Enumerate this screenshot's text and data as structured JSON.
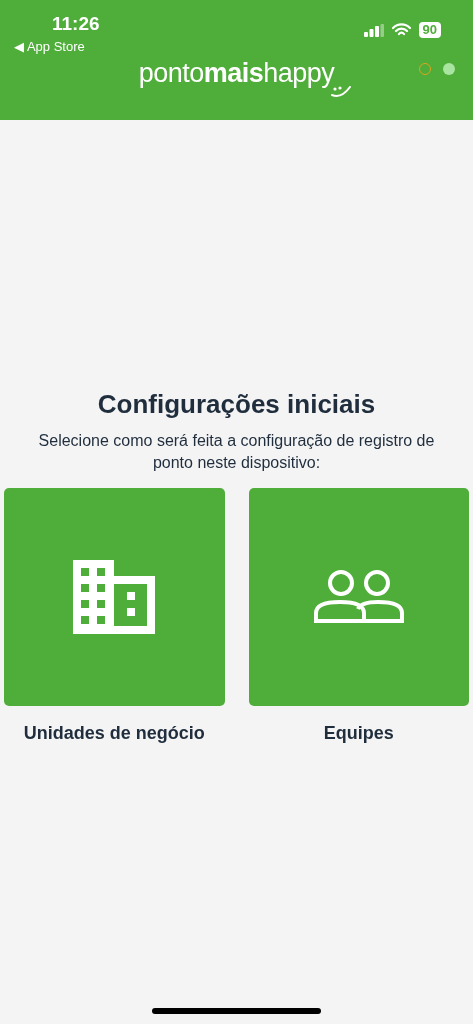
{
  "status_bar": {
    "time": "11:26",
    "back_link": "◀ App Store",
    "battery": "90"
  },
  "header": {
    "logo": "ponto**mais**happy",
    "indicators": [
      {
        "color": "#d9a520",
        "filled": false
      },
      {
        "color": "#a9e4a0",
        "filled": true
      }
    ]
  },
  "title": "Configurações iniciais",
  "subtitle": "Selecione como será feita a configuração de registro de ponto neste dispositivo:",
  "options": [
    {
      "kind": "building",
      "label": "Unidades de negócio"
    },
    {
      "kind": "team",
      "label": "Equipes"
    }
  ]
}
